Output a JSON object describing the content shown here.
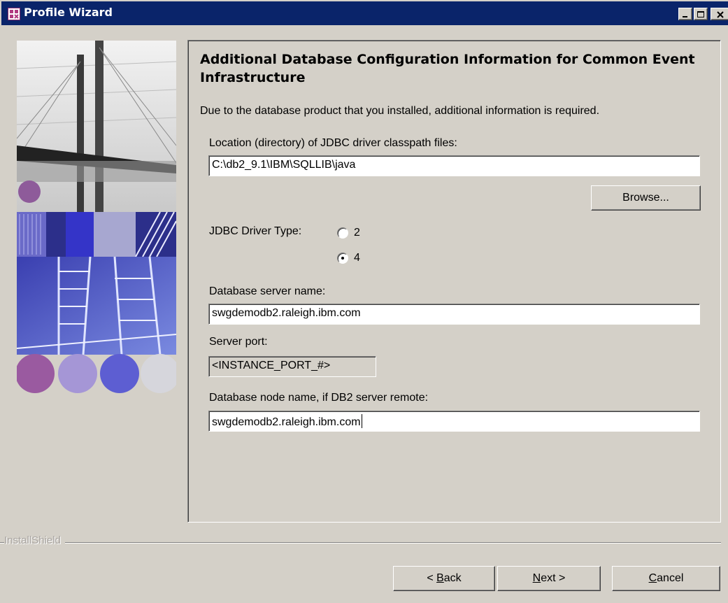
{
  "window": {
    "title": "Profile Wizard",
    "icon": "wizard-app-icon"
  },
  "heading": "Additional Database Configuration Information for Common Event Infrastructure",
  "intro": "Due to the database product that you installed, additional information is required.",
  "jdbc_location": {
    "label": "Location (directory) of JDBC driver classpath files:",
    "value": "C:\\db2_9.1\\IBM\\SQLLIB\\java"
  },
  "browse_label": "Browse...",
  "driver_type": {
    "label": "JDBC Driver Type:",
    "options": [
      "2",
      "4"
    ],
    "selected": "4"
  },
  "server_name": {
    "label": "Database server name:",
    "value": "swgdemodb2.raleigh.ibm.com"
  },
  "server_port": {
    "label": "Server port:",
    "value": "<INSTANCE_PORT_#>"
  },
  "node_name": {
    "label": "Database node name, if DB2 server remote:",
    "value": "swgdemodb2.raleigh.ibm.com"
  },
  "brand": "InstallShield",
  "nav": {
    "back_prefix": "< ",
    "back_key": "B",
    "back_rest": "ack",
    "next_key": "N",
    "next_rest": "ext >",
    "cancel_key": "C",
    "cancel_rest": "ancel"
  },
  "colors": {
    "titlebar": "#0a246a",
    "window_bg": "#d4d0c8"
  }
}
